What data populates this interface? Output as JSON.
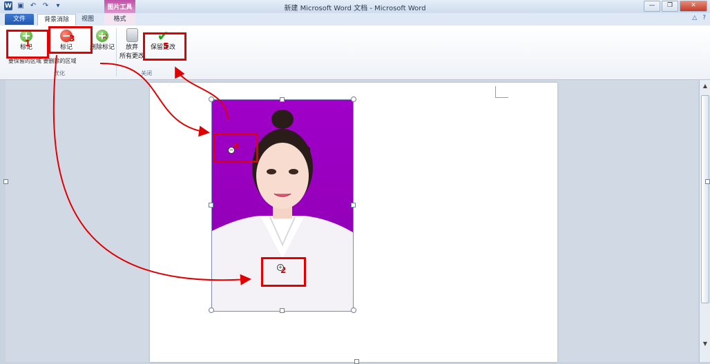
{
  "window": {
    "title": "新建 Microsoft Word 文档 - Microsoft Word",
    "picture_tools_label": "图片工具"
  },
  "tabs": {
    "file": "文件",
    "background_removal": "背景消除",
    "view": "视图",
    "format": "格式"
  },
  "ribbon": {
    "mark_keep_label": "标记",
    "mark_remove_label": "标记",
    "delete_mark_label": "删除标记",
    "discard_label": "放弃",
    "discard_label2": "所有更改",
    "keep_changes_label": "保留更改",
    "keep_areas_text": "要保留的区域 要删除的区域",
    "group_optimize": "优化",
    "group_close": "关闭"
  },
  "annotations": {
    "n1": "1",
    "n2": "2",
    "n3": "3",
    "n4": "4",
    "n5": "5",
    "color": "#e00000"
  },
  "colors": {
    "photo_background": "#a000c8",
    "accent": "#2b5797"
  }
}
